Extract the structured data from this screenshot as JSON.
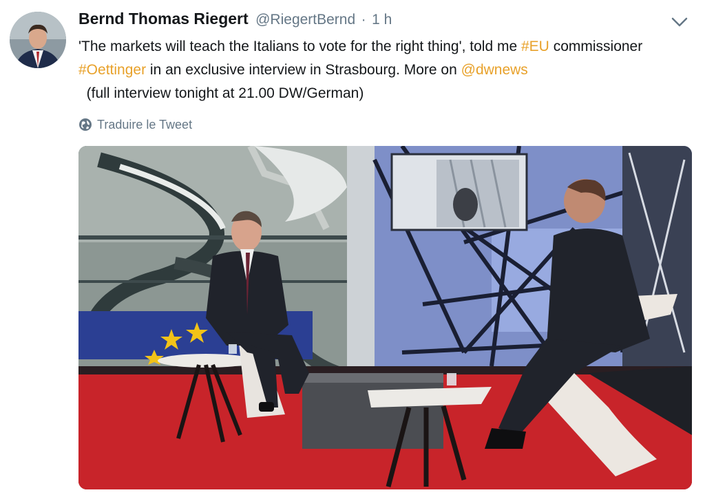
{
  "tweet": {
    "author_name": "Bernd Thomas Riegert",
    "author_handle": "@RiegertBernd",
    "separator": "·",
    "time": "1 h",
    "text_parts": [
      "'The markets will teach the Italians to vote for the right thing', told me ",
      "#EU",
      " commissioner ",
      "#Oettinger",
      " in an exclusive interview in Strasbourg. More on ",
      "@dwnews",
      "  (full interview tonight at 21.00 DW/German)"
    ],
    "translate_label": "Traduire le Tweet"
  },
  "icons": {
    "caret": "chevron-down-icon",
    "globe": "globe-icon"
  },
  "colors": {
    "link": "#e8a12a",
    "text": "#14171a",
    "muted": "#657786",
    "stage_red": "#c8242a",
    "flag_blue": "#2b3f93",
    "flag_star": "#f2c318"
  }
}
